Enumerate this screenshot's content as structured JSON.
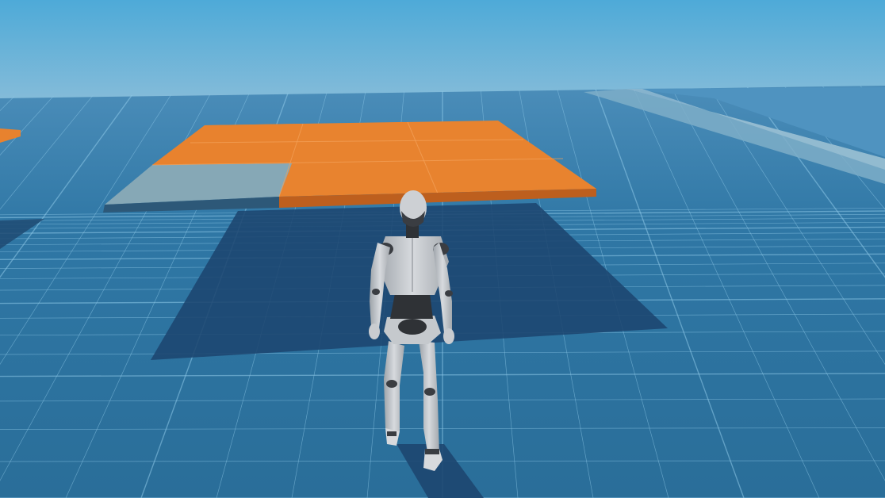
{
  "scene": {
    "kind": "3d-prototype-level",
    "colors": {
      "sky_top": "#5aa8d3",
      "sky_bottom": "#7fb7d8",
      "floor": "#2e73a0",
      "floor_far": "#4a8dba",
      "grid_line": "#8cc6e6",
      "platform_orange": "#e8822e",
      "platform_gray": "#7fa6b6",
      "shadow": "#1f4a72",
      "character_body": "#c9ccd0",
      "character_joint": "#3a3d42"
    }
  }
}
